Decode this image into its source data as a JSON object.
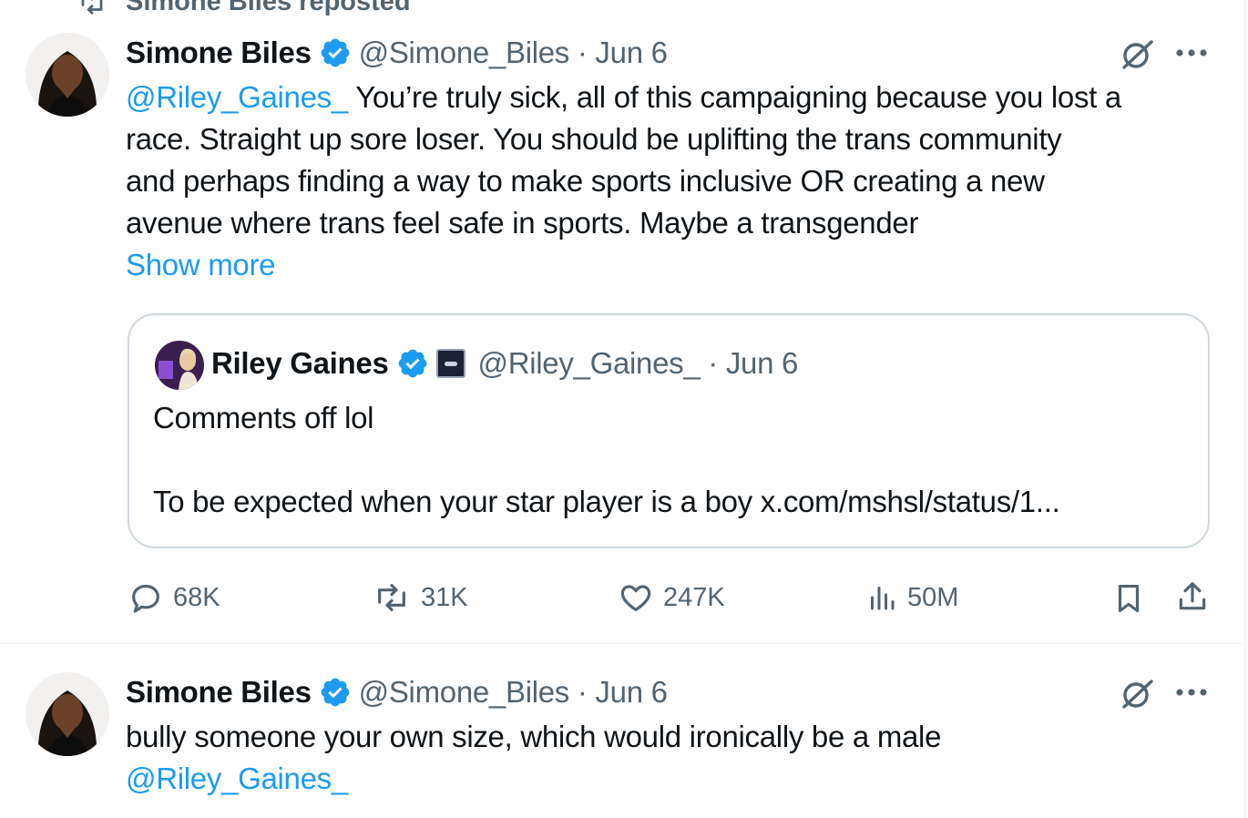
{
  "repost_banner": {
    "text": "Simone Biles reposted"
  },
  "tweet1": {
    "author_name": "Simone Biles",
    "handle_date": "@Simone_Biles · Jun 6",
    "mention": "@Riley_Gaines_",
    "text_line1": " You’re truly sick, all of this campaigning because you lost a",
    "text_line2": "race. Straight up sore loser. You should be uplifting the trans community",
    "text_line3": "and perhaps finding a way to make sports inclusive OR creating a new",
    "text_line4": "avenue where trans feel safe in sports. Maybe a transgender",
    "show_more": "Show more",
    "quote": {
      "author_name": "Riley Gaines",
      "handle_date": "@Riley_Gaines_ · Jun 6",
      "line1": "Comments off lol",
      "line2": "To be expected when your star player is a boy x.com/mshsl/status/1..."
    },
    "actions": {
      "replies": "68K",
      "reposts": "31K",
      "likes": "247K",
      "views": "50M"
    }
  },
  "tweet2": {
    "author_name": "Simone Biles",
    "handle_date": "@Simone_Biles · Jun 6",
    "text_line1": "bully someone your own size, which would ironically be a male",
    "mention": "@Riley_Gaines_"
  },
  "colors": {
    "accent": "#1d9bf0",
    "muted": "#536471",
    "text": "#0f1419",
    "border": "#cfd9de"
  }
}
